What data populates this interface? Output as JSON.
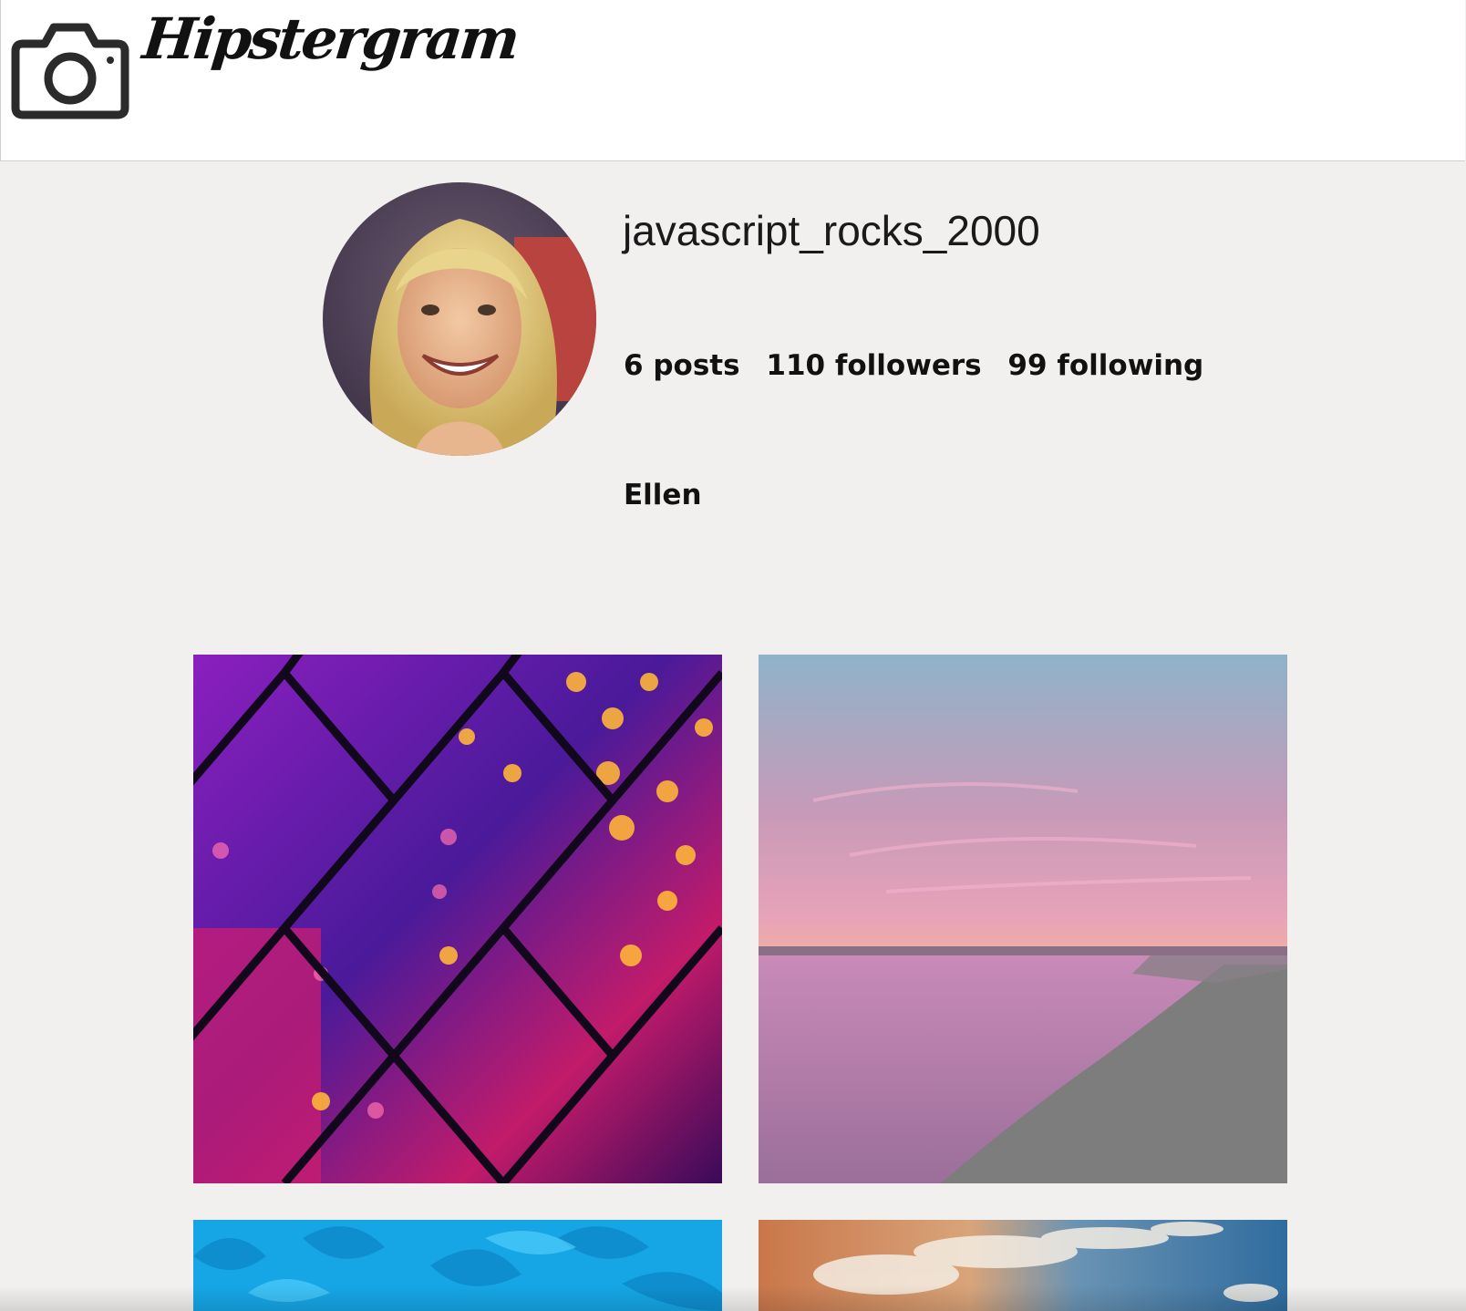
{
  "header": {
    "brand": "Hipstergram",
    "logo_icon": "camera-icon"
  },
  "profile": {
    "avatar_icon": "avatar",
    "username": "javascript_rocks_2000",
    "stats": {
      "posts": "6 posts",
      "followers": "110 followers",
      "following": "99 following"
    },
    "full_name": "Ellen"
  },
  "posts": [
    {
      "subject": "chain-link fence with bokeh lights"
    },
    {
      "subject": "pink sunset over water"
    },
    {
      "subject": "blue flower petals"
    },
    {
      "subject": "clouds in blue sky"
    }
  ],
  "colors": {
    "background": "#f1f0ef",
    "header_bg": "#ffffff",
    "text": "#111111"
  }
}
